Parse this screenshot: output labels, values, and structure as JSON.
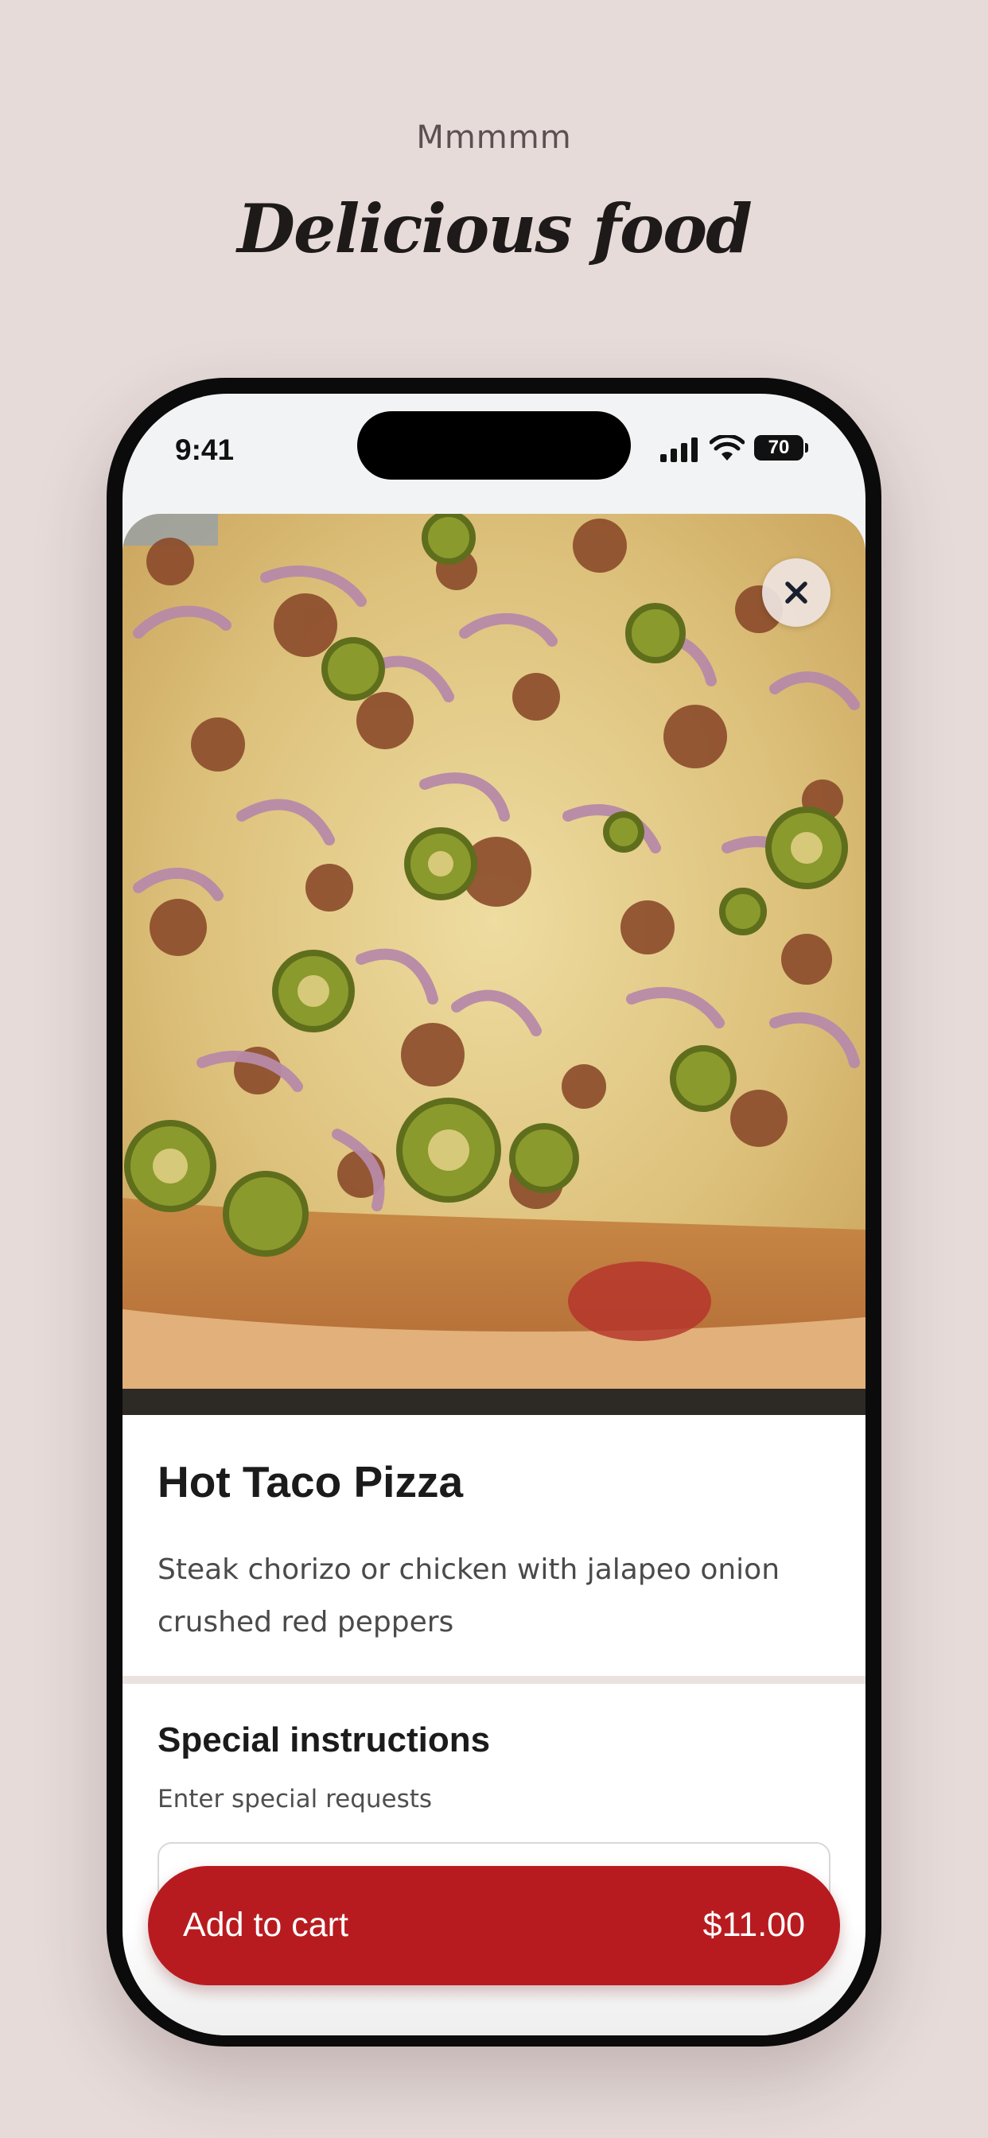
{
  "promo": {
    "eyebrow": "Mmmmm",
    "headline": "Delicious food"
  },
  "status_bar": {
    "time": "9:41",
    "battery": "70"
  },
  "item": {
    "image_alt": "Hot Taco Pizza photo",
    "name": "Hot Taco Pizza",
    "description": "Steak chorizo or chicken with jalapeo onion crushed red peppers"
  },
  "special_instructions": {
    "title": "Special instructions",
    "subtitle": "Enter special requests",
    "placeholder": ""
  },
  "cart_button": {
    "label": "Add to cart",
    "price": "$11.00"
  },
  "colors": {
    "accent": "#b81b1f",
    "background": "#e6dbd9"
  }
}
